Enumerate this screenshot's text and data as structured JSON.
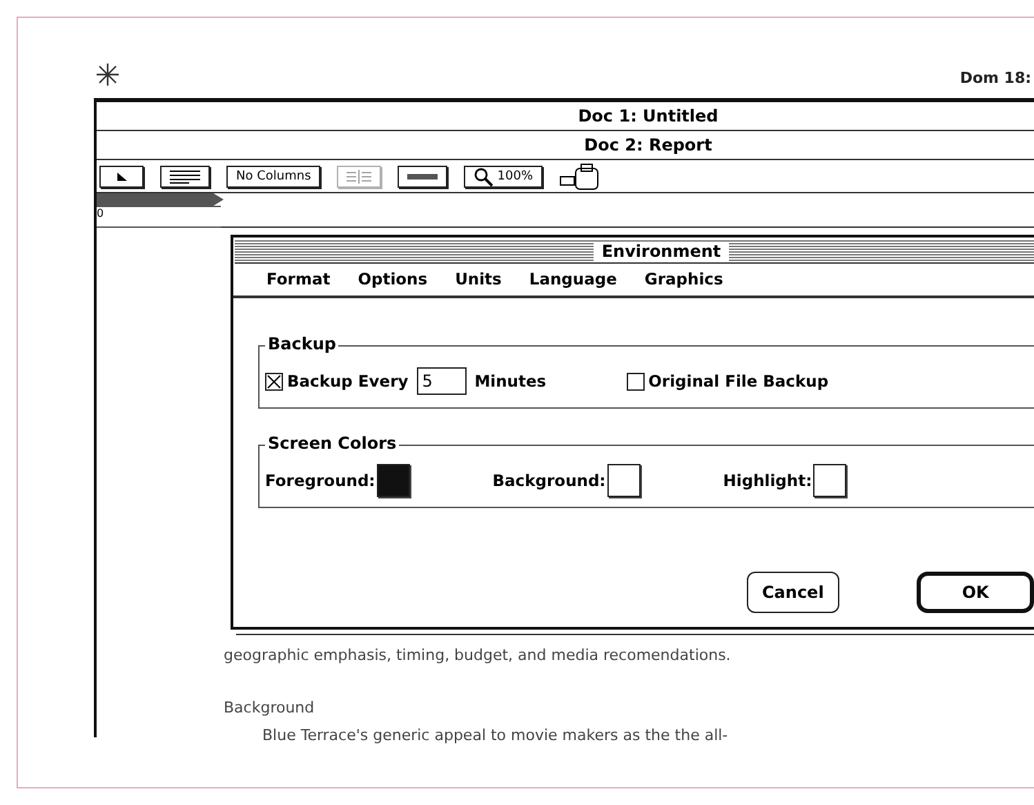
{
  "menubar": {
    "clock": "Dom 18:"
  },
  "windows": [
    {
      "title": "Doc 1: Untitled"
    },
    {
      "title": "Doc 2: Report"
    }
  ],
  "toolbar": [
    {
      "kind": "pointer",
      "disabled": false
    },
    {
      "kind": "lines",
      "disabled": false
    },
    {
      "kind": "text",
      "label": "No Columns",
      "disabled": false
    },
    {
      "kind": "columns",
      "disabled": true
    },
    {
      "kind": "rule",
      "disabled": false
    },
    {
      "kind": "zoom",
      "label": "100%",
      "disabled": false
    },
    {
      "kind": "clip",
      "disabled": false
    }
  ],
  "ruler": {
    "origin": "0"
  },
  "document": {
    "lines": [
      {
        "kind": "body",
        "text": "geographic emphasis, timing, budget, and media recomendations."
      },
      {
        "kind": "heading",
        "text": "Background"
      },
      {
        "kind": "indent",
        "text": "Blue Terrace's generic appeal to movie makers as the the all-"
      }
    ]
  },
  "dialog": {
    "title": "Environment",
    "menu": [
      {
        "label": "Format"
      },
      {
        "label": "Options"
      },
      {
        "label": "Units"
      },
      {
        "label": "Language"
      },
      {
        "label": "Graphics"
      }
    ],
    "backup": {
      "title": "Backup",
      "every": {
        "label": "Backup Every",
        "checked": true
      },
      "minutes": {
        "value": "5",
        "unit": "Minutes"
      },
      "original": {
        "label": "Original File Backup",
        "checked": false
      }
    },
    "colors": {
      "title": "Screen Colors",
      "items": [
        {
          "label": "Foreground:",
          "color": "#111111"
        },
        {
          "label": "Background:",
          "color": "#ffffff"
        },
        {
          "label": "Highlight:",
          "color": "#ffffff"
        }
      ]
    },
    "buttons": [
      {
        "label": "Cancel",
        "kind": "normal"
      },
      {
        "label": "OK",
        "kind": "default"
      }
    ]
  }
}
